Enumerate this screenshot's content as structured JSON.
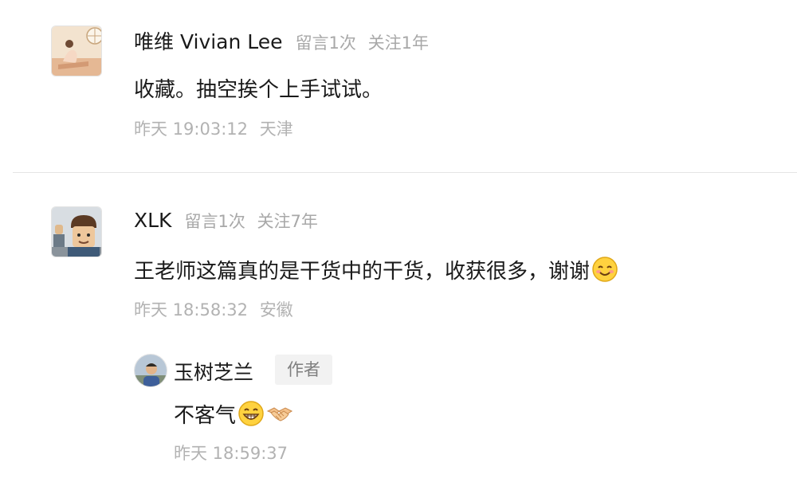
{
  "comments": [
    {
      "name": "唯维 Vivian Lee",
      "messages": "留言1次",
      "follow": "关注1年",
      "content": "收藏。抽空挨个上手试试。",
      "time": "昨天 19:03:12",
      "location": "天津",
      "avatar_icon": "person-photo-avatar"
    },
    {
      "name": "XLK",
      "messages": "留言1次",
      "follow": "关注7年",
      "content": "王老师这篇真的是干货中的干货，收获很多，谢谢",
      "content_emoji": "smiling-face-icon",
      "time": "昨天 18:58:32",
      "location": "安徽",
      "avatar_icon": "lego-figure-avatar",
      "reply": {
        "name": "玉树芝兰",
        "badge": "作者",
        "content": "不客气",
        "emojis": [
          "grinning-face-icon",
          "handshake-icon"
        ],
        "time": "昨天 18:59:37",
        "avatar_icon": "person-photo-avatar"
      }
    }
  ],
  "colors": {
    "text": "#1a1a1a",
    "meta": "#a8a8a8",
    "time": "#b2b2b2",
    "badge_bg": "#f2f2f2",
    "badge_text": "#7f7f7f",
    "divider": "#e5e5e5"
  }
}
